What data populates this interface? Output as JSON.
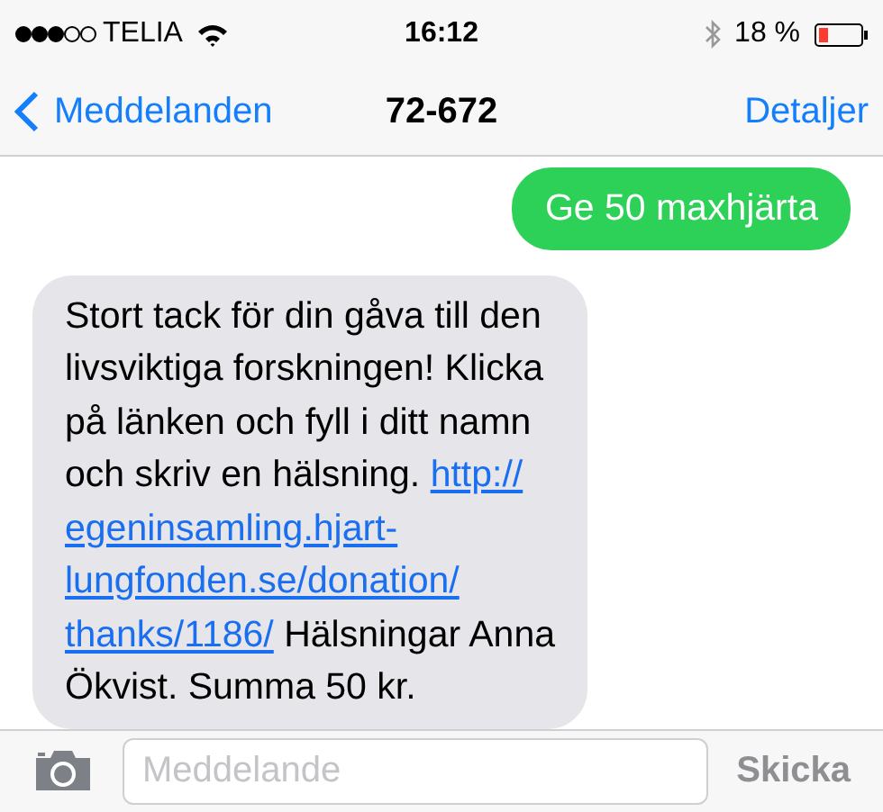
{
  "status_bar": {
    "carrier": "TELIA",
    "time": "16:12",
    "battery": "18 %"
  },
  "nav": {
    "back": "Meddelanden",
    "title": "72-672",
    "action": "Detaljer"
  },
  "messages": [
    {
      "kind": "sent",
      "lines": [
        [
          {
            "kind": "text",
            "text": "Ge 50 maxhjärta"
          }
        ]
      ]
    },
    {
      "kind": "received",
      "lines": [
        [
          {
            "kind": "text",
            "text": "Stort tack för din gåva till den"
          }
        ],
        [
          {
            "kind": "text",
            "text": "livsviktiga forskningen! Klicka"
          }
        ],
        [
          {
            "kind": "text",
            "text": "på länken och fyll i ditt namn"
          }
        ],
        [
          {
            "kind": "text",
            "text": "och skriv en hälsning. "
          },
          {
            "kind": "link",
            "text": "http://"
          }
        ],
        [
          {
            "kind": "link",
            "text": "egeninsamling.hjart-"
          }
        ],
        [
          {
            "kind": "link",
            "text": "lungfonden.se/donation/"
          }
        ],
        [
          {
            "kind": "link",
            "text": "thanks/1186/"
          },
          {
            "kind": "text",
            "text": " Hälsningar Anna"
          }
        ],
        [
          {
            "kind": "text",
            "text": "Ökvist. Summa 50 kr."
          }
        ]
      ]
    }
  ],
  "composer": {
    "placeholder": "Meddelande",
    "send": "Skicka"
  }
}
